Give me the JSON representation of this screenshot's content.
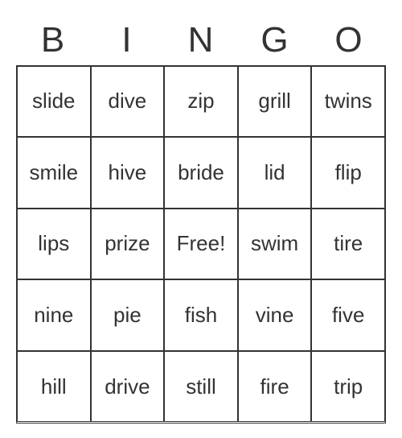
{
  "header": [
    "B",
    "I",
    "N",
    "G",
    "O"
  ],
  "grid": [
    [
      "slide",
      "dive",
      "zip",
      "grill",
      "twins"
    ],
    [
      "smile",
      "hive",
      "bride",
      "lid",
      "flip"
    ],
    [
      "lips",
      "prize",
      "Free!",
      "swim",
      "tire"
    ],
    [
      "nine",
      "pie",
      "fish",
      "vine",
      "five"
    ],
    [
      "hill",
      "drive",
      "still",
      "fire",
      "trip"
    ]
  ]
}
